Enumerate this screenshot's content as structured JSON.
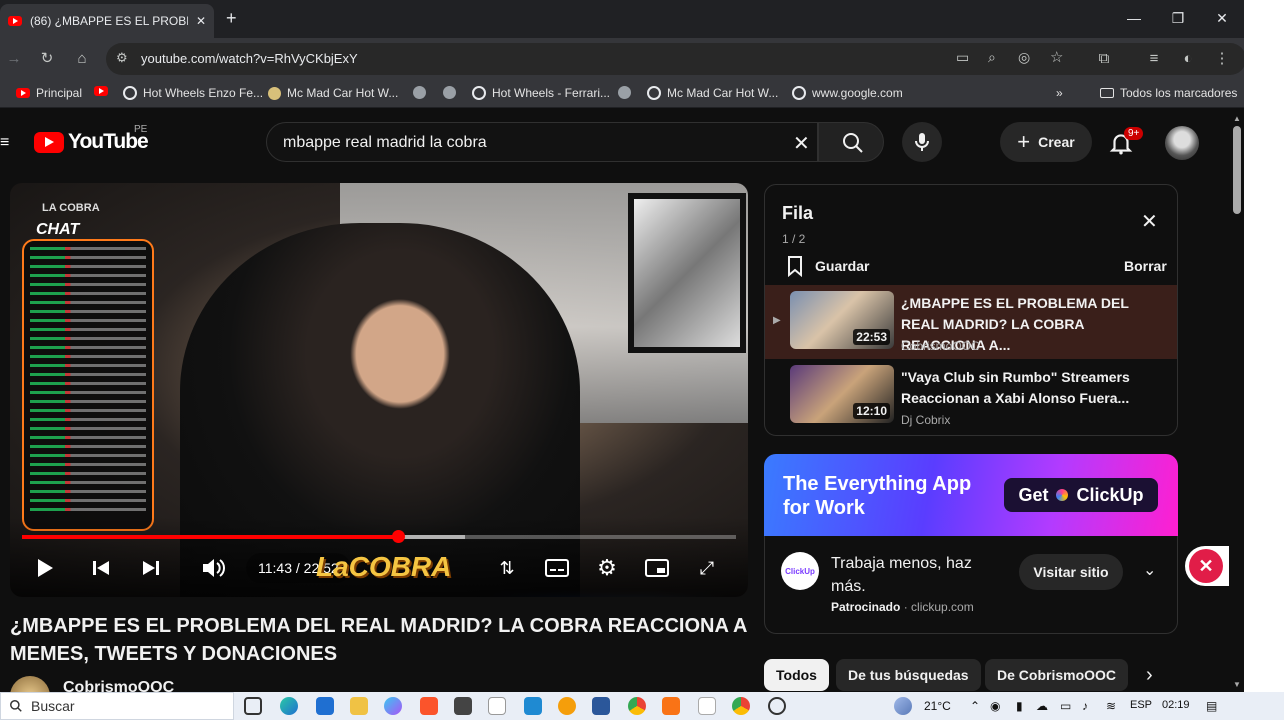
{
  "browser": {
    "tab_title": "(86) ¿MBAPPE ES EL PROBLEMA",
    "new_tab": "+",
    "url": "youtube.com/watch?v=RhVyCKbjExY",
    "bookmarks": [
      "Principal",
      "Hot Wheels Enzo Fe...",
      "Mc Mad Car Hot W...",
      "Hot Wheels - Ferrari...",
      "Mc Mad Car Hot W...",
      "www.google.com"
    ],
    "all_bookmarks": "Todos los marcadores"
  },
  "yt": {
    "logo": "YouTube",
    "country": "PE",
    "search_query": "mbappe real madrid la cobra",
    "create": "Crear",
    "notif_count": "9+"
  },
  "video": {
    "chat_label": "LA COBRA",
    "chat_title": "CHAT",
    "time": "11:43 / 22:52",
    "progress": 0.527,
    "buffered": 0.62,
    "overlay_logo": "LaCOBRA",
    "title": "¿MBAPPE ES EL PROBLEMA DEL REAL MADRID? LA COBRA REACCIONA A MEMES, TWEETS Y DONACIONES",
    "channel": "CobrismoOOC"
  },
  "queue": {
    "title": "Fila",
    "count": "1 / 2",
    "save": "Guardar",
    "clear": "Borrar",
    "items": [
      {
        "title": "¿MBAPPE ES EL PROBLEMA DEL REAL MADRID? LA COBRA REACCIONA A...",
        "channel": "CobrismoOOC",
        "duration": "22:53"
      },
      {
        "title": "\"Vaya Club sin Rumbo\" Streamers Reaccionan a Xabi Alonso Fuera...",
        "channel": "Dj Cobrix",
        "duration": "12:10"
      }
    ]
  },
  "ad": {
    "headline_1": "The Everything App",
    "headline_2": "for Work",
    "cta_banner": "Get",
    "brand": "ClickUp",
    "copy": "Trabaja menos, haz más.",
    "sponsored": "Patrocinado",
    "domain": "clickup.com",
    "visit": "Visitar sitio"
  },
  "chips": [
    "Todos",
    "De tus búsquedas",
    "De CobrismoOOC"
  ],
  "taskbar": {
    "search": "Buscar",
    "temp": "21°C",
    "lang": "ESP",
    "time": "02:19"
  },
  "colors": {
    "accent": "#ff0000",
    "bg": "#0f0f0f"
  }
}
